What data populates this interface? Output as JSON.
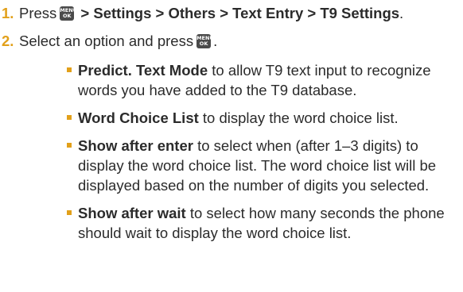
{
  "steps": [
    {
      "number": "1.",
      "text_before_key": "Press",
      "key": {
        "line1": "MENU",
        "line2": "OK"
      },
      "path": " > Settings > Others > Text Entry > T9 Settings",
      "end": "."
    },
    {
      "number": "2.",
      "text_before_key": "Select an option and press",
      "key": {
        "line1": "MENU",
        "line2": "OK"
      },
      "end": "."
    }
  ],
  "options": [
    {
      "term": "Predict. Text Mode",
      "description": " to allow T9 text input to recognize words you have added to the T9 database."
    },
    {
      "term": "Word Choice List",
      "description": " to display the word choice list."
    },
    {
      "term": "Show after enter",
      "description": " to select when (after 1–3 digits) to display the word choice list. The word choice list will be displayed based on the number of digits you selected."
    },
    {
      "term": "Show after wait",
      "description": " to select how many seconds the phone should wait to display the word choice list."
    }
  ],
  "colors": {
    "accent": "#e2a01a",
    "text": "#2b2b2b",
    "key_bg": "#4a4a4a"
  }
}
